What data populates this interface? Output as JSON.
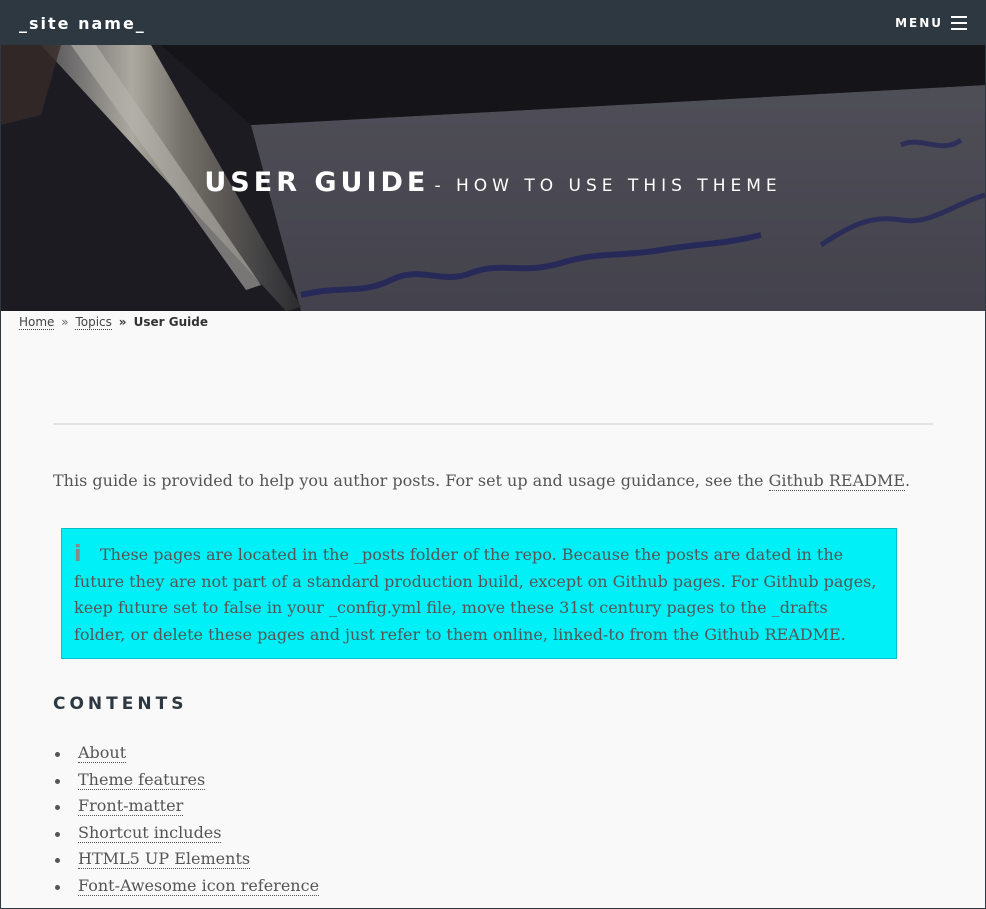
{
  "header": {
    "site_name": "_site name_",
    "menu_label": "MENU"
  },
  "hero": {
    "title": "USER GUIDE",
    "subtitle": "- HOW TO USE THIS THEME"
  },
  "breadcrumb": {
    "items": [
      "Home",
      "Topics"
    ],
    "separator": "»",
    "current": "User Guide"
  },
  "intro": {
    "text": "This guide is provided to help you author posts. For set up and usage guidance, see the ",
    "link": "Github README",
    "end": "."
  },
  "notice": {
    "icon": "info-icon",
    "text": "These pages are located in the _posts folder of the repo. Because the posts are dated in the future they are not part of a standard production build, except on Github pages. For Github pages, keep future set to false in your _config.yml file, move these 31st century pages to the _drafts folder, or delete these pages and just refer to them online, linked-to from the Github README.",
    "background": "#00f0f8"
  },
  "contents": {
    "heading": "CONTENTS",
    "items": [
      "About",
      "Theme features",
      "Front-matter",
      "Shortcut includes",
      "HTML5 UP Elements",
      "Font-Awesome icon reference"
    ]
  },
  "colors": {
    "topbar": "#2e3840",
    "page_bg": "#f9f9f9",
    "notice_bg": "#00f0f8"
  }
}
